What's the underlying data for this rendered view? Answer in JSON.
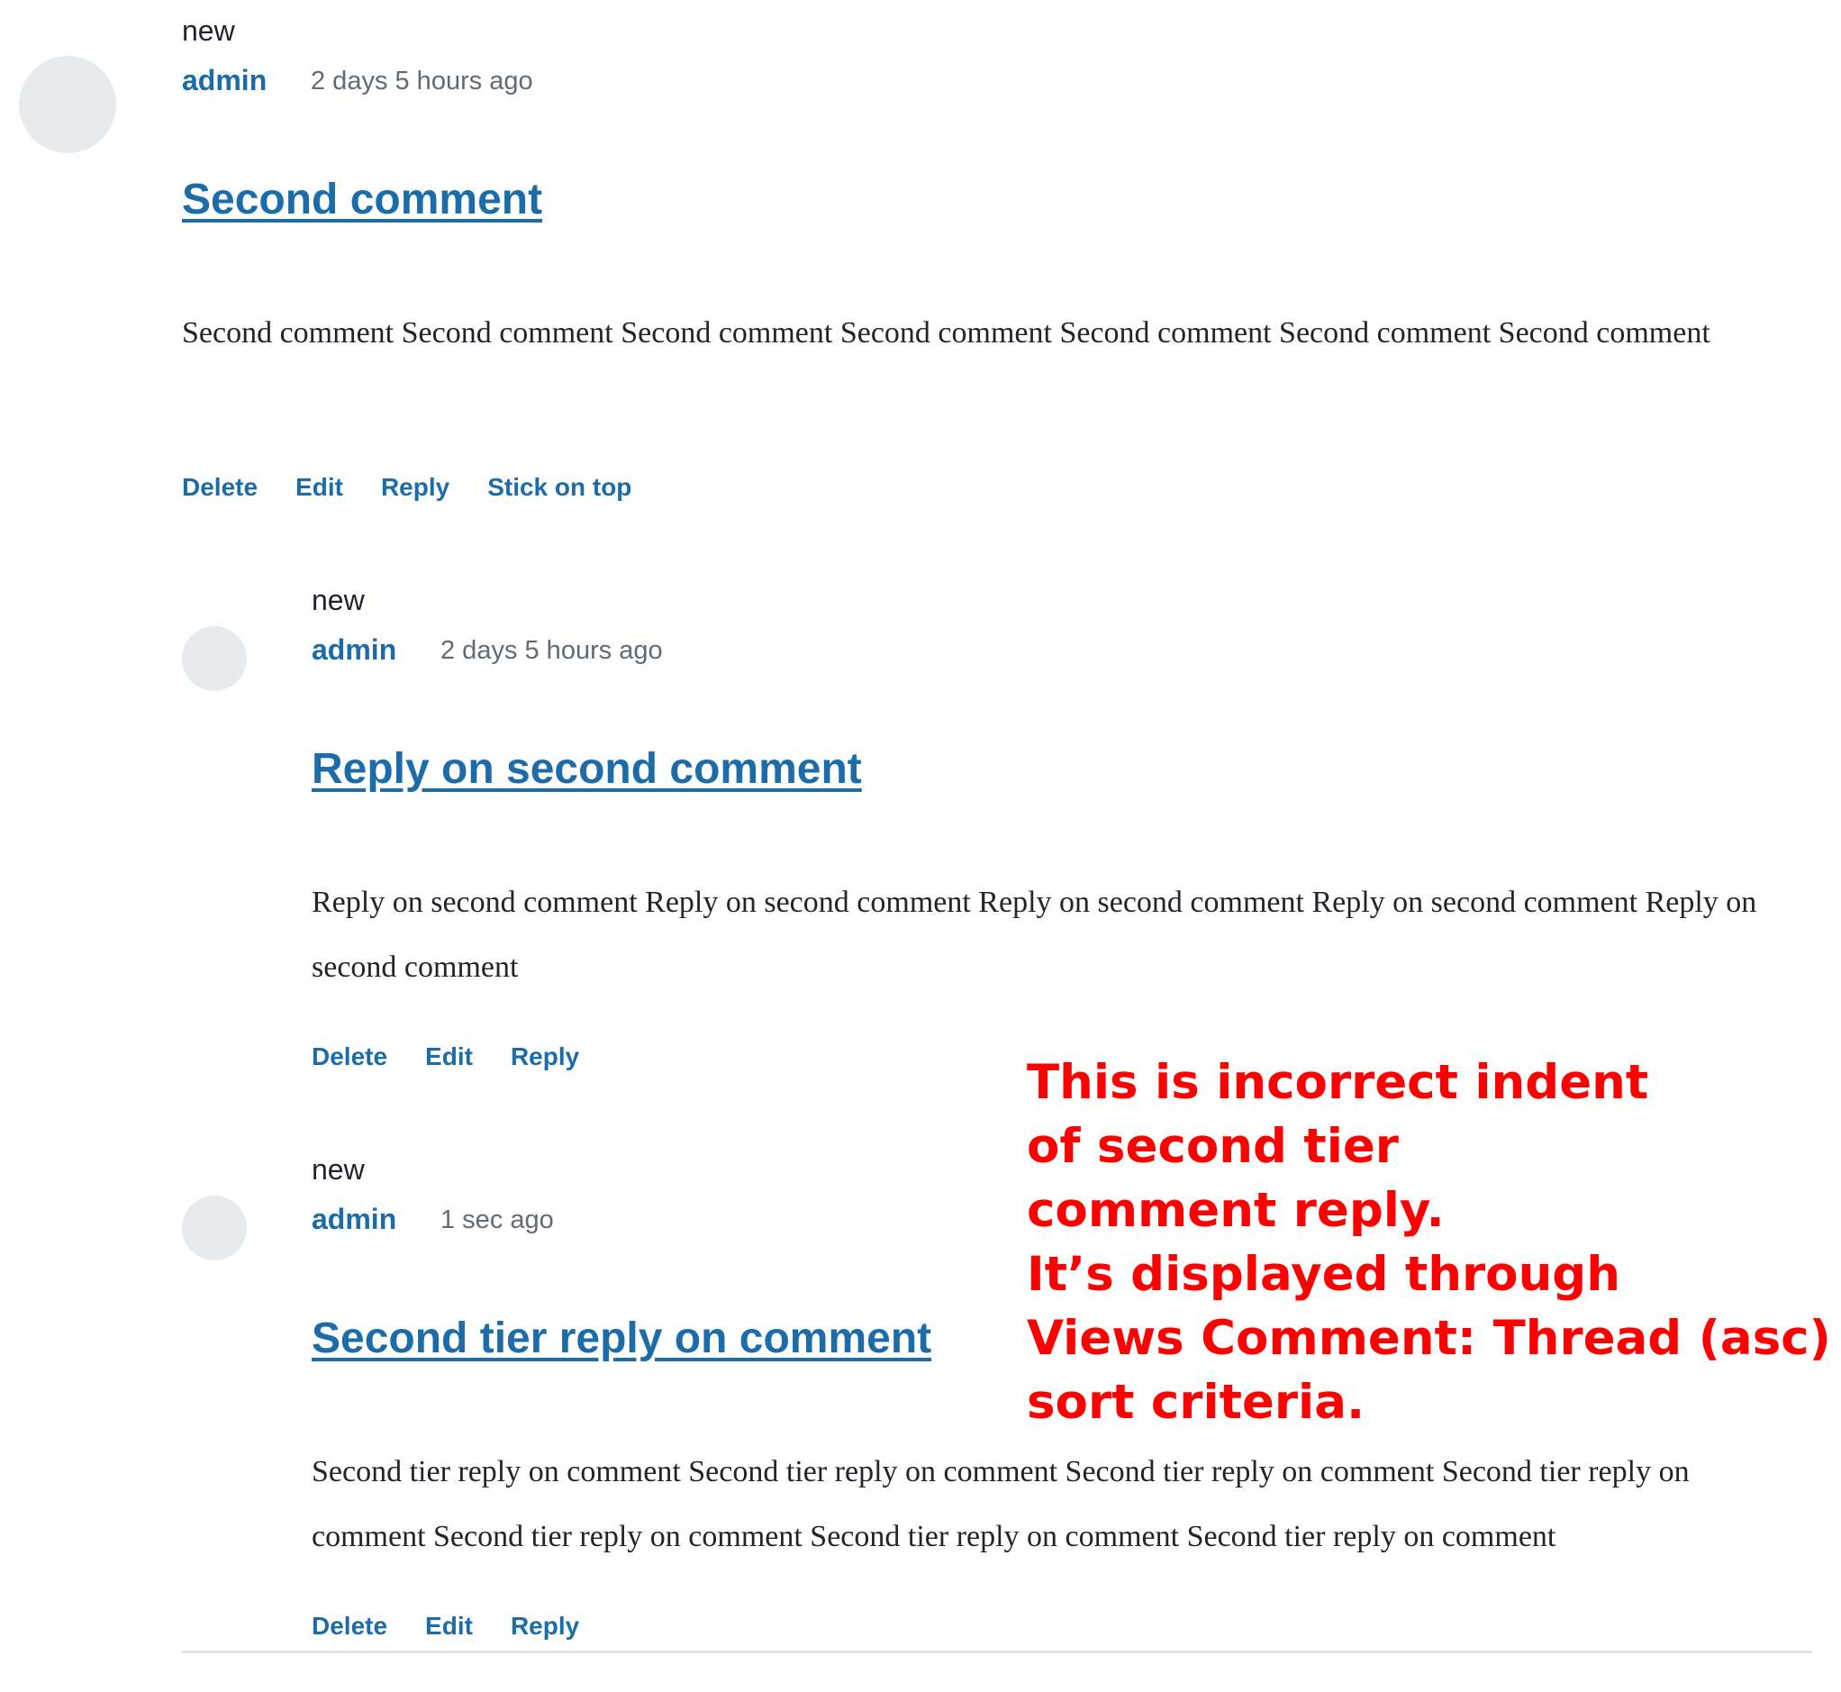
{
  "comments": [
    {
      "new_label": "new",
      "author": "admin",
      "time": "2 days 5 hours ago",
      "title": "Second comment",
      "body": "Second comment Second comment Second comment Second comment Second comment Second comment Second comment",
      "links": [
        "Delete",
        "Edit",
        "Reply",
        "Stick on top"
      ]
    },
    {
      "new_label": "new",
      "author": "admin",
      "time": "2 days 5 hours ago",
      "title": "Reply on second comment",
      "body": "Reply on second comment Reply on second comment Reply on second comment Reply on second comment Reply on second comment",
      "links": [
        "Delete",
        "Edit",
        "Reply"
      ]
    },
    {
      "new_label": "new",
      "author": "admin",
      "time": "1 sec ago",
      "title": "Second tier reply on comment",
      "body": "Second tier reply on comment Second tier reply on comment Second tier reply on comment Second tier reply on comment Second tier reply on comment Second tier reply on comment Second tier reply on comment",
      "links": [
        "Delete",
        "Edit",
        "Reply"
      ]
    }
  ],
  "annotation": {
    "lines": [
      "This is incorrect indent",
      "of second tier",
      "comment reply.",
      "It’s displayed through",
      "Views Comment: Thread (asc)",
      "sort criteria."
    ],
    "color": "#ff0000"
  },
  "colors": {
    "link": "#1b6ca8",
    "avatar": "#e8ebee",
    "text": "#232429",
    "meta": "#626a75"
  }
}
